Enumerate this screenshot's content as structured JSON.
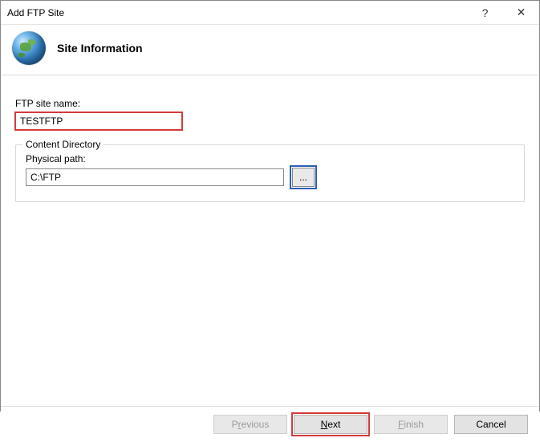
{
  "window": {
    "title": "Add FTP Site",
    "help": "?",
    "close": "✕"
  },
  "header": {
    "title": "Site Information"
  },
  "form": {
    "site_name_label": "FTP site name:",
    "site_name_value": "TESTFTP",
    "content_dir_legend": "Content Directory",
    "physical_path_label": "Physical path:",
    "physical_path_value": "C:\\FTP",
    "browse_label": "..."
  },
  "footer": {
    "previous_pre": "P",
    "previous_ul": "r",
    "previous_post": "evious",
    "next_ul": "N",
    "next_post": "ext",
    "finish_pre": "",
    "finish_ul": "F",
    "finish_post": "inish",
    "cancel": "Cancel"
  }
}
